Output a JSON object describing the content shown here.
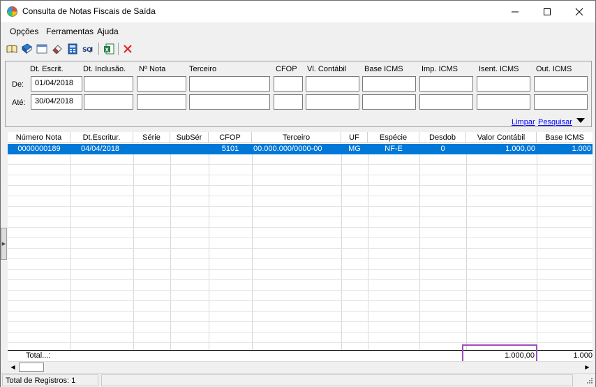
{
  "window": {
    "title": "Consulta de Notas Fiscais de Saída",
    "minimize": "—",
    "maximize": "☐",
    "close": "✕"
  },
  "menu": [
    "Opções",
    "Ferramentas",
    "Ajuda"
  ],
  "toolbar": {
    "icons": [
      "open-book-icon",
      "book-blue-icon",
      "window-icon",
      "eraser-icon",
      "calculator-icon",
      "sql-icon",
      "excel-export-icon",
      "close-red-icon"
    ]
  },
  "filter": {
    "headers": [
      "Dt. Escrit.",
      "Dt. Inclusão.",
      "Nº Nota",
      "Terceiro",
      "CFOP",
      "Vl. Contábil",
      "Base ICMS",
      "Imp. ICMS",
      "Isent. ICMS",
      "Out. ICMS"
    ],
    "row_from_label": "De:",
    "row_to_label": "Até:",
    "from": {
      "dt_escrit": "01/04/2018",
      "dt_inclusao": "",
      "nota": "",
      "terceiro": "",
      "cfop": "",
      "vl_contabil": "",
      "base_icms": "",
      "imp_icms": "",
      "isent_icms": "",
      "out_icms": ""
    },
    "to": {
      "dt_escrit": "30/04/2018",
      "dt_inclusao": "",
      "nota": "",
      "terceiro": "",
      "cfop": "",
      "vl_contabil": "",
      "base_icms": "",
      "imp_icms": "",
      "isent_icms": "",
      "out_icms": ""
    },
    "clear_link": "Limpar",
    "search_link": "Pesquisar"
  },
  "grid": {
    "columns": [
      "Número Nota",
      "Dt.Escritur.",
      "Série",
      "SubSér",
      "CFOP",
      "Terceiro",
      "UF",
      "Espécie",
      "Desdob",
      "Valor Contábil",
      "Base ICMS"
    ],
    "rows": [
      [
        "0000000189",
        "04/04/2018",
        "",
        "",
        "5101",
        "00.000.000/0000-00",
        "MG",
        "NF-E",
        "0",
        "1.000,00",
        "1.000"
      ]
    ],
    "totals_label": "Total...:",
    "total_valor_contabil": "1.000,00",
    "total_base_icms": "1.000"
  },
  "status": {
    "records": "Total de Registros: 1"
  },
  "colors": {
    "selection": "#0078d7",
    "highlight_box": "#a14dbd",
    "link": "#0000ff"
  }
}
